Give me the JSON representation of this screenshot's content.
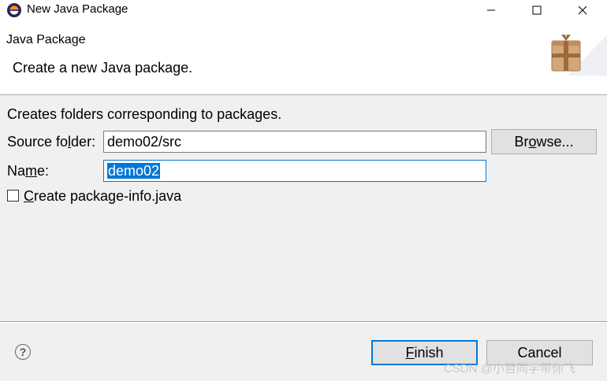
{
  "window": {
    "title": "New Java Package",
    "icon": "eclipse-icon",
    "controls": [
      "minimize-icon",
      "maximize-icon",
      "close-icon"
    ]
  },
  "header": {
    "title": "Java Package",
    "description": "Create a new Java package.",
    "banner_icon": "package-icon"
  },
  "form": {
    "description": "Creates folders corresponding to packages.",
    "source_folder_label_pre": "Source fo",
    "source_folder_label_mn": "l",
    "source_folder_label_post": "der:",
    "source_folder_value": "demo02/src",
    "browse_label_pre": "Br",
    "browse_label_mn": "o",
    "browse_label_post": "wse...",
    "name_label_pre": "Na",
    "name_label_mn": "m",
    "name_label_post": "e:",
    "name_value": "demo02",
    "checkbox_label_mn": "C",
    "checkbox_label_post": "reate package-info.java",
    "checkbox_checked": false
  },
  "footer": {
    "help_icon": "help-icon",
    "help_glyph": "?",
    "finish_label_mn": "F",
    "finish_label_post": "inish",
    "cancel_label": "Cancel",
    "watermark": "CSDN @小哲同学带你飞"
  },
  "colors": {
    "accent": "#0078d7",
    "background": "#f0f0f0",
    "header_background": "#ffffff"
  }
}
